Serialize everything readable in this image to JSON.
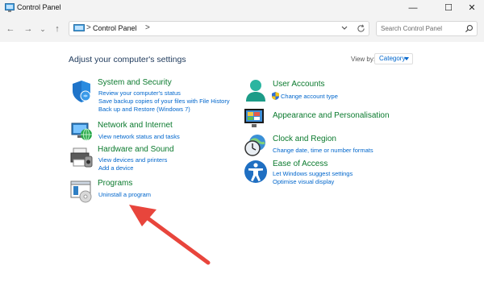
{
  "window": {
    "title": "Control Panel"
  },
  "titlebar_buttons": {
    "minimize": "—",
    "maximize": "☐",
    "close": "✕"
  },
  "nav": {
    "back": "←",
    "forward": "→",
    "recent": "⌄",
    "up": "↑"
  },
  "address": {
    "separator": ">",
    "path": "Control Panel",
    "trailing": ">"
  },
  "search": {
    "placeholder": "Search Control Panel"
  },
  "heading": "Adjust your computer's settings",
  "view_by": {
    "label": "View by:",
    "value": "Category"
  },
  "categories": [
    {
      "title": "System and Security",
      "links": [
        "Review your computer's status",
        "Save backup copies of your files with File History",
        "Back up and Restore (Windows 7)"
      ]
    },
    {
      "title": "Network and Internet",
      "links": [
        "View network status and tasks"
      ]
    },
    {
      "title": "Hardware and Sound",
      "links": [
        "View devices and printers",
        "Add a device"
      ]
    },
    {
      "title": "Programs",
      "links": [
        "Uninstall a program"
      ]
    },
    {
      "title": "User Accounts",
      "links": [
        "Change account type"
      ]
    },
    {
      "title": "Appearance and Personalisation",
      "links": []
    },
    {
      "title": "Clock and Region",
      "links": [
        "Change date, time or number formats"
      ]
    },
    {
      "title": "Ease of Access",
      "links": [
        "Let Windows suggest settings",
        "Optimise visual display"
      ]
    }
  ],
  "colors": {
    "category_title": "#0b7a2e",
    "link": "#0066cc",
    "heading": "#1e395b",
    "annotation_arrow": "#e8453c"
  }
}
